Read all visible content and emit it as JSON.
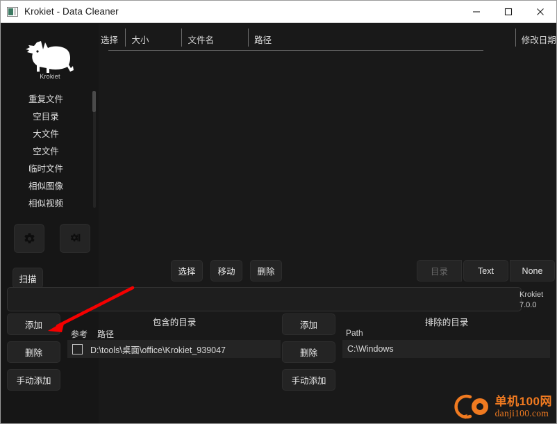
{
  "window": {
    "title": "Krokiet - Data Cleaner",
    "app_icon": "app-window-icon",
    "minimize_label": "—",
    "maximize_label": "□",
    "close_label": "✕"
  },
  "sidebar": {
    "logo_caption": "Krokiet",
    "items": [
      {
        "label": "重复文件"
      },
      {
        "label": "空目录"
      },
      {
        "label": "大文件"
      },
      {
        "label": "空文件"
      },
      {
        "label": "临时文件"
      },
      {
        "label": "相似图像"
      },
      {
        "label": "相似视频"
      }
    ],
    "settings_icon": "gear-icon",
    "about_icon": "settings-sliders-icon",
    "scan_label": "扫描"
  },
  "results": {
    "columns": [
      {
        "label": "选择"
      },
      {
        "label": "大小"
      },
      {
        "label": "文件名"
      },
      {
        "label": "路径"
      },
      {
        "label": "修改日期"
      }
    ]
  },
  "actions": {
    "select_label": "选择",
    "move_label": "移动",
    "delete_label": "删除",
    "dir_label": "目录",
    "text_label": "Text",
    "none_label": "None"
  },
  "status": {
    "message": "",
    "version_name": "Krokiet",
    "version_number": "7.0.0"
  },
  "included": {
    "title": "包含的目录",
    "add_label": "添加",
    "delete_label": "删除",
    "manual_add_label": "手动添加",
    "col_reference": "参考",
    "col_path": "路径",
    "rows": [
      {
        "checked": false,
        "path": "D:\\tools\\桌面\\office\\Krokiet_939047"
      }
    ]
  },
  "excluded": {
    "title": "排除的目录",
    "add_label": "添加",
    "delete_label": "删除",
    "manual_add_label": "手动添加",
    "col_path": "Path",
    "rows": [
      {
        "path": "C:\\Windows"
      }
    ]
  },
  "annotation": {
    "arrow_color": "#f40000",
    "arrow_from": "190,413",
    "arrow_to": "70,474"
  },
  "watermark": {
    "cn": "单机100网",
    "en": "danji100.com",
    "color": "#f07a20"
  }
}
